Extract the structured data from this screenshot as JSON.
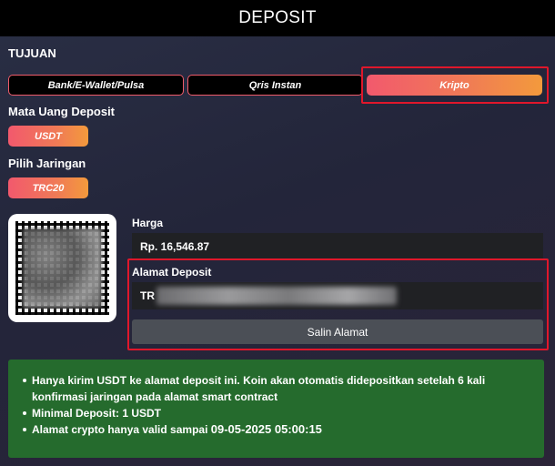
{
  "header": {
    "title": "DEPOSIT"
  },
  "tujuan": {
    "label": "TUJUAN",
    "tabs": [
      {
        "label": "Bank/E-Wallet/Pulsa",
        "active": false
      },
      {
        "label": "Qris Instan",
        "active": false
      },
      {
        "label": "Kripto",
        "active": true
      }
    ]
  },
  "currency": {
    "label": "Mata Uang Deposit",
    "value": "USDT"
  },
  "network": {
    "label": "Pilih Jaringan",
    "value": "TRC20"
  },
  "price": {
    "label": "Harga",
    "value": "Rp. 16,546.87"
  },
  "address": {
    "label": "Alamat Deposit",
    "prefix": "TR",
    "copy_label": "Salin Alamat"
  },
  "info": {
    "line1": "Hanya kirim USDT ke alamat deposit ini. Koin akan otomatis didepositkan setelah 6 kali konfirmasi jaringan pada alamat smart contract",
    "line2": "Minimal Deposit: 1 USDT",
    "line3_prefix": "Alamat crypto hanya valid sampai ",
    "line3_date": "09-05-2025 05:00:15"
  },
  "colors": {
    "accent_gradient_start": "#f2596d",
    "accent_gradient_end": "#f39a3c",
    "highlight_red": "#e0172b",
    "info_green": "#256b2d"
  }
}
